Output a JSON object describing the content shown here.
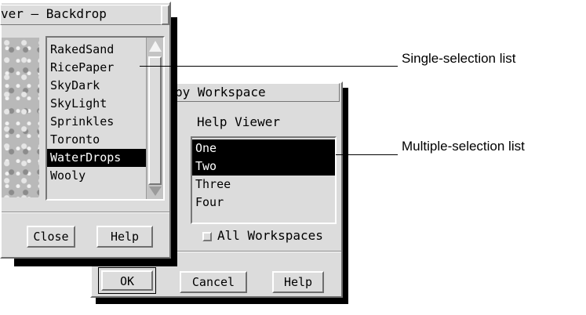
{
  "backdrop_window": {
    "title": "ver – Backdrop",
    "items": [
      {
        "label": "RakedSand",
        "selected": false
      },
      {
        "label": "RicePaper",
        "selected": false
      },
      {
        "label": "SkyDark",
        "selected": false
      },
      {
        "label": "SkyLight",
        "selected": false
      },
      {
        "label": "Sprinkles",
        "selected": false
      },
      {
        "label": "Toronto",
        "selected": false
      },
      {
        "label": "WaterDrops",
        "selected": true
      },
      {
        "label": "Wooly",
        "selected": false
      }
    ],
    "close_label": "Close",
    "help_label": "Help"
  },
  "copy_window": {
    "title": "py Workspace",
    "subtitle": "Help Viewer",
    "items": [
      {
        "label": "One",
        "selected": true
      },
      {
        "label": "Two",
        "selected": true
      },
      {
        "label": "Three",
        "selected": false
      },
      {
        "label": "Four",
        "selected": false
      }
    ],
    "checkbox_label": "All Workspaces",
    "ok_label": "OK",
    "cancel_label": "Cancel",
    "help_label": "Help"
  },
  "callouts": {
    "single": "Single-selection list",
    "multiple": "Multiple-selection list"
  }
}
